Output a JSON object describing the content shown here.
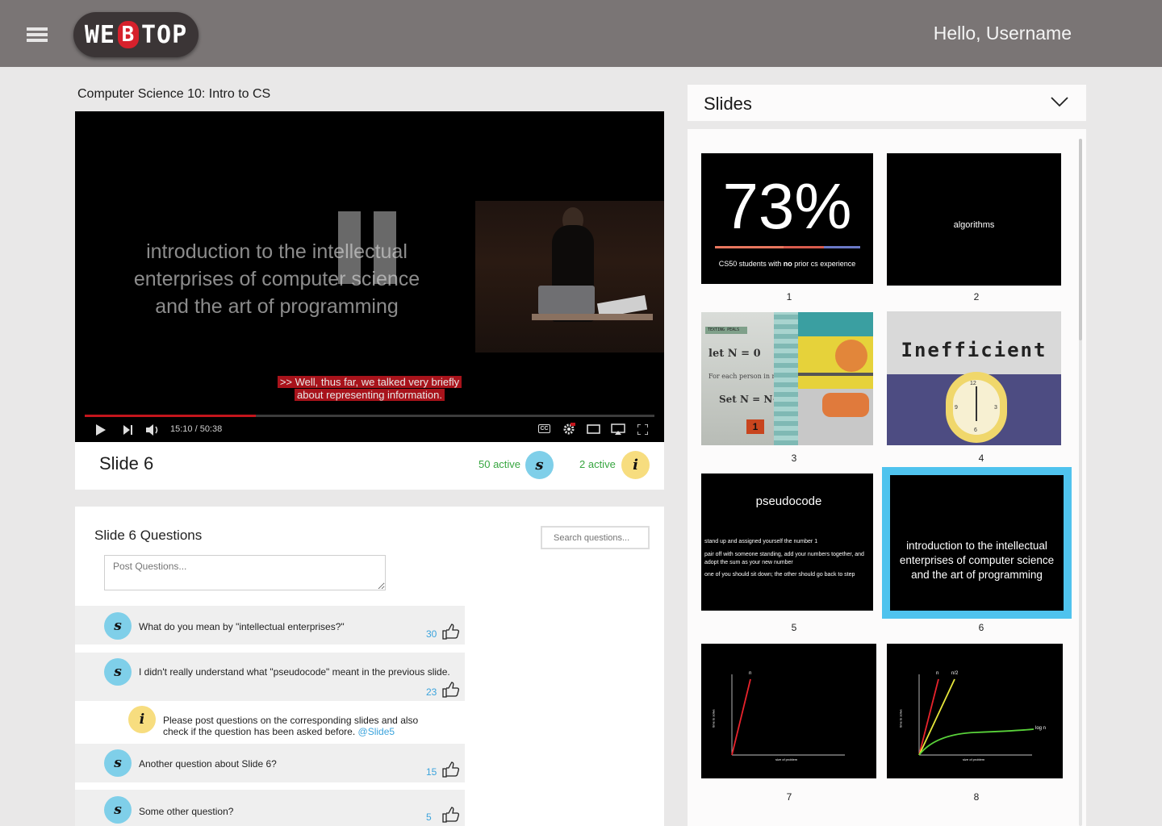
{
  "header": {
    "logo_left": "WE",
    "logo_badge": "B",
    "logo_right": "TOP",
    "greeting": "Hello, Username"
  },
  "course": {
    "title": "Computer Science 10: Intro to CS"
  },
  "video": {
    "slide_text": [
      "introduction to the intellectual",
      "enterprises of computer science",
      "and the art of programming"
    ],
    "caption_line1": ">> Well, thus far, we talked very briefly",
    "caption_line2": "about representing information.",
    "time": "15:10 / 50:38",
    "progress_fraction": 0.3,
    "cc_label": "CC"
  },
  "slide_bar": {
    "name": "Slide 6",
    "students_active": "50 active",
    "instructors_active": "2 active",
    "student_badge": "s",
    "instructor_badge": "i"
  },
  "questions": {
    "title": "Slide 6 Questions",
    "search_placeholder": "Search questions...",
    "post_placeholder": "Post Questions...",
    "items": [
      {
        "badge": "s",
        "text": "What do you mean by \"intellectual enterprises?\"",
        "votes": "30"
      },
      {
        "badge": "s",
        "text": "I didn't really understand what \"pseudocode\" meant in the previous slide.",
        "votes": "23"
      },
      {
        "badge": "i",
        "text_line1": "Please post questions on the corresponding slides and also",
        "text_line2": "check if the question has been asked before.",
        "mention": "@Slide5"
      },
      {
        "badge": "s",
        "text": "Another question about Slide 6?",
        "votes": "15"
      },
      {
        "badge": "s",
        "text": "Some other question?",
        "votes": "5"
      }
    ]
  },
  "slides_panel": {
    "title": "Slides",
    "selected": 6,
    "thumbs": [
      {
        "number": "1",
        "big": "73%",
        "caption_pre": "CS50 students with ",
        "caption_bold": "no",
        "caption_post": " prior cs experience"
      },
      {
        "number": "2",
        "text": "algorithms"
      },
      {
        "number": "3",
        "tag": "TEXTING PEALS",
        "line1": "let N = 0",
        "line2": "For each person in room",
        "line3": "Set N = N+1",
        "box": "1"
      },
      {
        "number": "4",
        "text": "Inefficient",
        "clock_numbers": [
          "12",
          "3",
          "6",
          "9"
        ]
      },
      {
        "number": "5",
        "title": "pseudocode",
        "line1": "stand up and assigned yourself the number 1",
        "line2": "pair off with someone standing, add your numbers together, and adopt the sum as your new number",
        "line3": "one of you should sit down; the other should go back to step"
      },
      {
        "number": "6",
        "line1": "introduction to the intellectual",
        "line2": "enterprises of computer science",
        "line3": "and the art of programming"
      },
      {
        "number": "7",
        "curve_label": "n",
        "ylabel": "time to solve",
        "xlabel": "size of problem"
      },
      {
        "number": "8",
        "curve1": "n",
        "curve2": "n/2",
        "curve3": "log n",
        "ylabel": "time to solve",
        "xlabel": "size of problem"
      }
    ]
  },
  "colors": {
    "header_bg": "#7a7575",
    "accent_blue": "#4fc3ee",
    "active_green": "#37a640",
    "vote_blue": "#3ba3dc",
    "caption_red": "#a8131b",
    "logo_red": "#d6212c"
  }
}
